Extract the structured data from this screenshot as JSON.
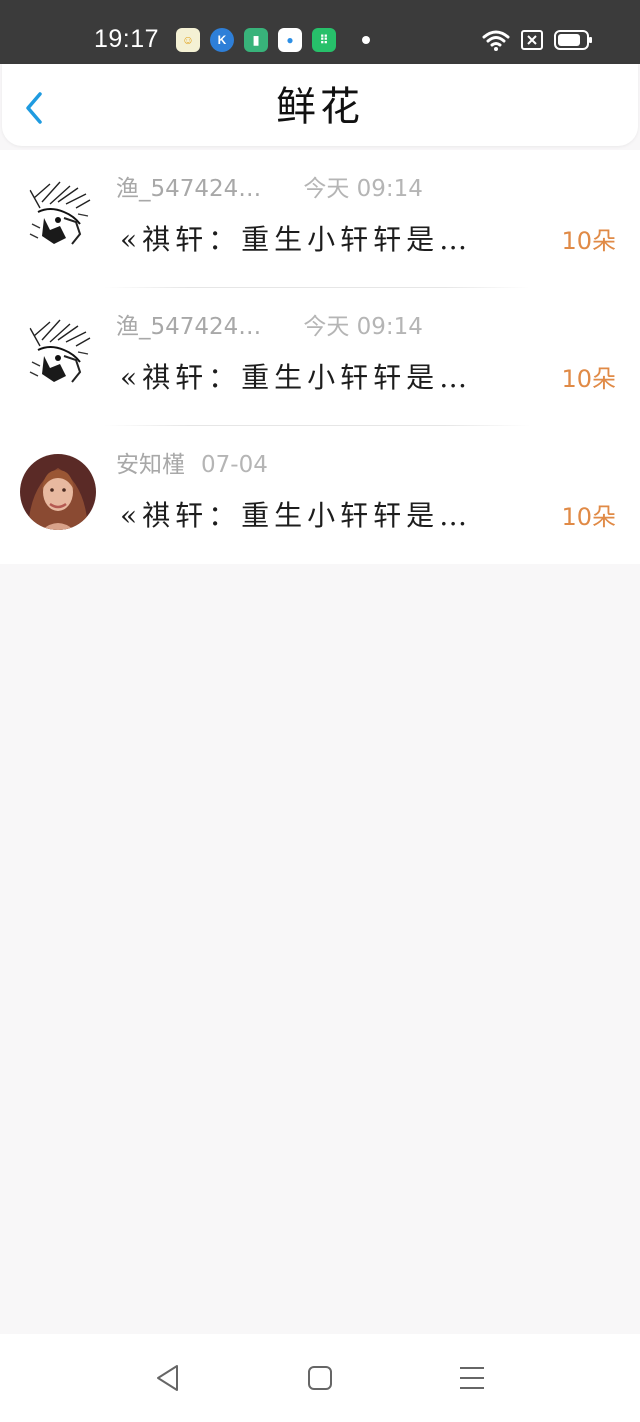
{
  "status_bar": {
    "time": "19:17",
    "notification_icons": [
      {
        "name": "weather-app-icon",
        "glyph": "☺",
        "bg": "#f4f1d4",
        "fg": "#e0a21c"
      },
      {
        "name": "k-app-icon",
        "glyph": "K",
        "bg": "#2e7fd8",
        "fg": "#ffffff"
      },
      {
        "name": "book-app-icon",
        "glyph": "▮",
        "bg": "#38b37a",
        "fg": "#ffffff"
      },
      {
        "name": "disc-app-icon",
        "glyph": "●",
        "bg": "#2d8fe5",
        "fg": "#ffffff"
      },
      {
        "name": "store-app-icon",
        "glyph": "⠿",
        "bg": "#27c06a",
        "fg": "#ffffff"
      }
    ]
  },
  "header": {
    "title": "鲜花",
    "back_icon": "chevron-left-icon",
    "accent_color": "#1f9be0"
  },
  "list": {
    "items": [
      {
        "username": "渔_547424…",
        "time": "今天 09:14",
        "message": "«祺轩：重生小轩轩是…",
        "count": "10朵",
        "avatar": "sketch-avatar"
      },
      {
        "username": "渔_547424…",
        "time": "今天 09:14",
        "message": "«祺轩：重生小轩轩是…",
        "count": "10朵",
        "avatar": "sketch-avatar"
      },
      {
        "username": "安知槿",
        "time": "07-04",
        "message": "«祺轩：重生小轩轩是…",
        "count": "10朵",
        "avatar": "photo-avatar"
      }
    ]
  },
  "nav_bar": {
    "icons": [
      "back-triangle-icon",
      "home-square-icon",
      "menu-lines-icon"
    ]
  },
  "colors": {
    "count_color": "#e08a46",
    "meta_color": "#a9a9a9",
    "page_bg": "#f8f7f8"
  }
}
